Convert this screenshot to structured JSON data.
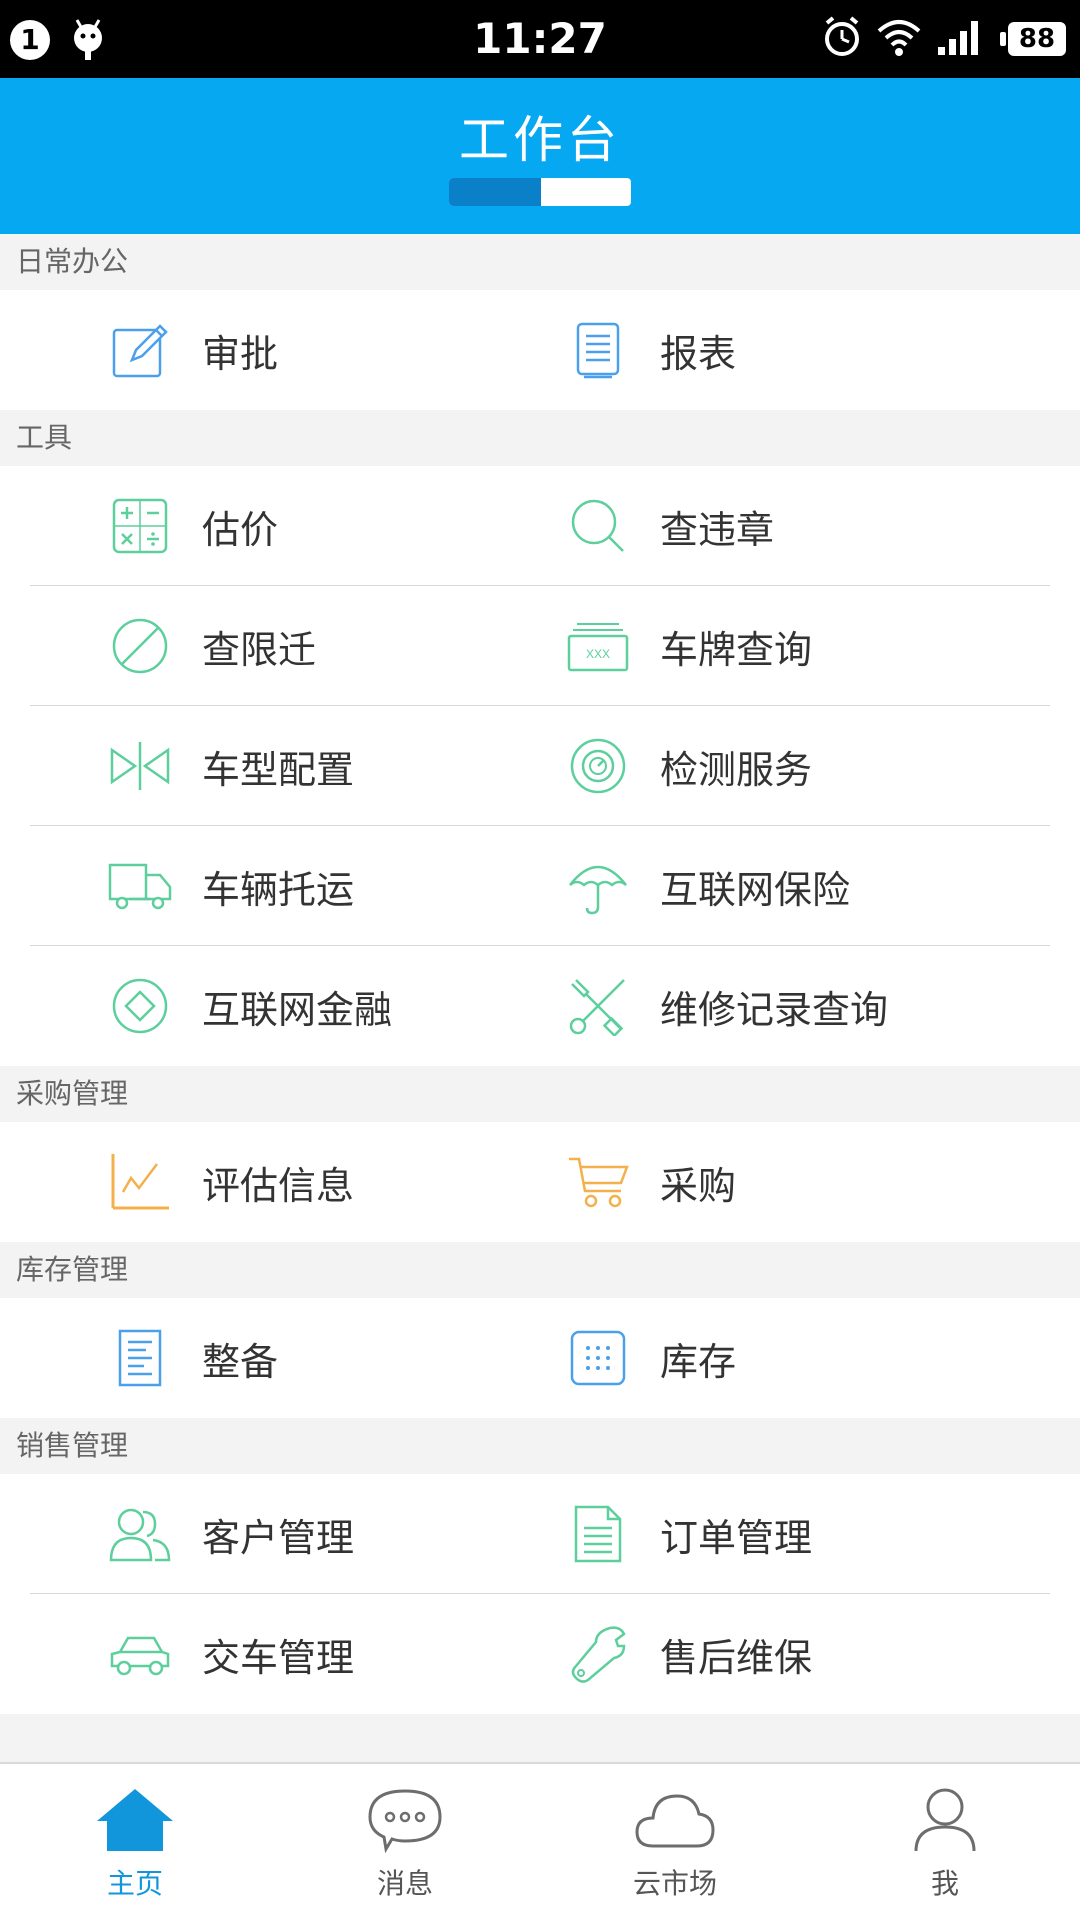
{
  "status_bar": {
    "notification_count": "1",
    "time": "11:27",
    "battery": "88"
  },
  "header": {
    "title": "工作台"
  },
  "sections": [
    {
      "title": "日常办公",
      "rows": [
        [
          {
            "label": "审批",
            "icon": "edit-icon"
          },
          {
            "label": "报表",
            "icon": "report-icon"
          }
        ]
      ]
    },
    {
      "title": "工具",
      "rows": [
        [
          {
            "label": "估价",
            "icon": "calculator-icon"
          },
          {
            "label": "查违章",
            "icon": "search-icon"
          }
        ],
        [
          {
            "label": "查限迁",
            "icon": "prohibited-icon"
          },
          {
            "label": "车牌查询",
            "icon": "license-plate-icon"
          }
        ],
        [
          {
            "label": "车型配置",
            "icon": "car-config-icon"
          },
          {
            "label": "检测服务",
            "icon": "inspection-icon"
          }
        ],
        [
          {
            "label": "车辆托运",
            "icon": "truck-icon"
          },
          {
            "label": "互联网保险",
            "icon": "umbrella-icon"
          }
        ],
        [
          {
            "label": "互联网金融",
            "icon": "finance-icon"
          },
          {
            "label": "维修记录查询",
            "icon": "repair-tools-icon"
          }
        ]
      ]
    },
    {
      "title": "采购管理",
      "rows": [
        [
          {
            "label": "评估信息",
            "icon": "line-chart-icon"
          },
          {
            "label": "采购",
            "icon": "cart-icon"
          }
        ]
      ]
    },
    {
      "title": "库存管理",
      "rows": [
        [
          {
            "label": "整备",
            "icon": "document-icon"
          },
          {
            "label": "库存",
            "icon": "grid-icon"
          }
        ]
      ]
    },
    {
      "title": "销售管理",
      "rows": [
        [
          {
            "label": "客户管理",
            "icon": "customers-icon"
          },
          {
            "label": "订单管理",
            "icon": "order-icon"
          }
        ],
        [
          {
            "label": "交车管理",
            "icon": "car-icon"
          },
          {
            "label": "售后维保",
            "icon": "wrench-icon"
          }
        ]
      ]
    }
  ],
  "tabs": [
    {
      "label": "主页",
      "icon": "home-icon",
      "active": true
    },
    {
      "label": "消息",
      "icon": "message-icon",
      "active": false
    },
    {
      "label": "云市场",
      "icon": "cloud-icon",
      "active": false
    },
    {
      "label": "我",
      "icon": "user-icon",
      "active": false
    }
  ],
  "colors": {
    "header": "#07a8f2",
    "toggle_active": "#0a80c8",
    "office_icon": "#4aa0ea",
    "tool_icon": "#5ccf9c",
    "purchase_icon": "#f4b04a",
    "inventory_icon": "#4aa0ea",
    "sales_icon": "#5ccf9c",
    "tab_active": "#1296db",
    "tab_inactive": "#6d6d6d"
  }
}
